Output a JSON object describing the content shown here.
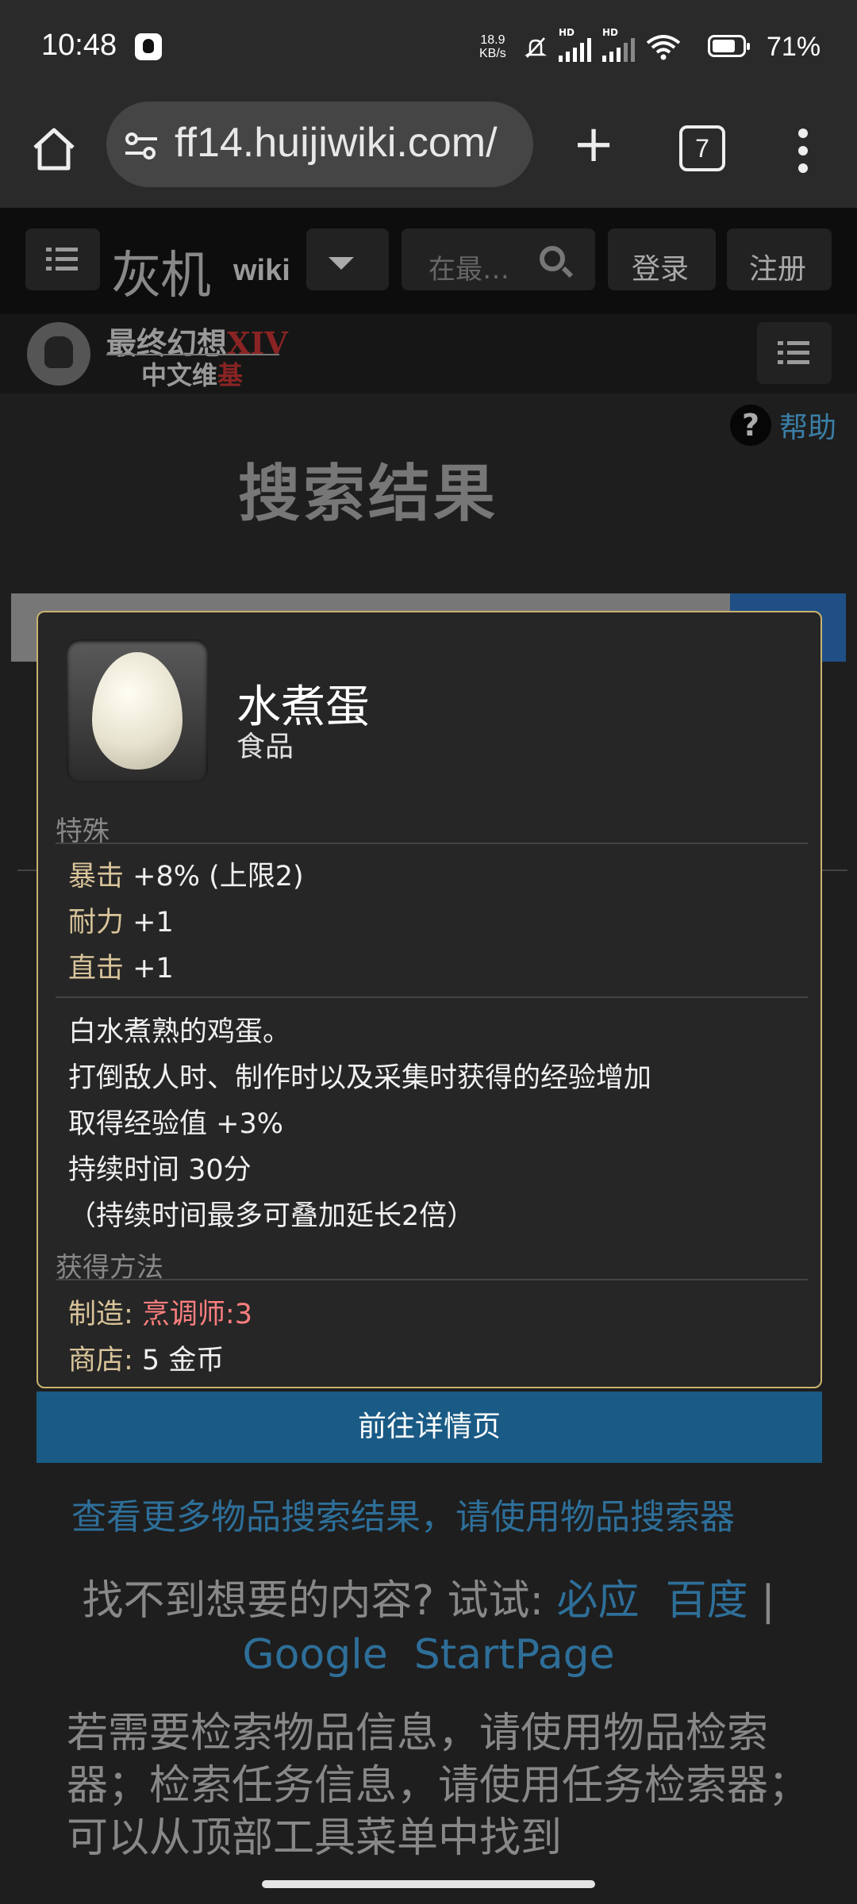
{
  "status_bar": {
    "time": "10:48",
    "net_speed_value": "18.9",
    "net_speed_unit": "KB/s",
    "signal_label_1": "HD",
    "signal_label_2": "HD",
    "battery_percent": "71%"
  },
  "browser": {
    "url": "ff14.huijiwiki.com/",
    "tab_count": "7"
  },
  "wiki_header": {
    "logo_main": "灰机",
    "logo_sub": "wiki",
    "search_placeholder": "在最…",
    "login_label": "登录",
    "register_label": "注册"
  },
  "site_header": {
    "title_main": "最终幻想",
    "title_accent": "XIV",
    "subtitle_main": "中文维",
    "subtitle_accent": "基"
  },
  "page": {
    "help_label": "帮助",
    "title": "搜索结果"
  },
  "item_card": {
    "name": "水煮蛋",
    "type": "食品",
    "special_heading": "特殊",
    "stats": [
      {
        "key": "暴击",
        "value": " +8% (上限2)"
      },
      {
        "key": "耐力",
        "value": " +1"
      },
      {
        "key": "直击",
        "value": " +1"
      }
    ],
    "description": [
      "白水煮熟的鸡蛋。",
      "打倒敌人时、制作时以及采集时获得的经验增加",
      "取得经验值 +3%",
      "持续时间 30分",
      "（持续时间最多可叠加延长2倍）"
    ],
    "obtain_heading": "获得方法",
    "craft_label": "制造: ",
    "craft_value": "烹调师:3",
    "shop_label": "商店: ",
    "shop_value": "5 金币"
  },
  "detail_button": "前往详情页",
  "more_results_link": "查看更多物品搜索结果，请使用物品搜索器",
  "not_found": {
    "prefix": "找不到想要的内容? 试试: ",
    "engine_1": "必应",
    "engine_2": "百度",
    "separator": " | ",
    "engine_3": "Google",
    "engine_4": "StartPage"
  },
  "tip_text": "若需要检索物品信息，请使用物品检索器；检索任务信息，请使用任务检索器；可以从顶部工具菜单中找到"
}
